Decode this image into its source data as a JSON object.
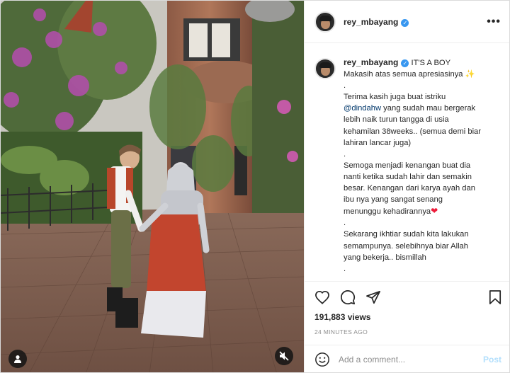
{
  "post": {
    "username": "rey_mbayang",
    "verified": true
  },
  "header": {
    "more_label": "•••"
  },
  "caption": {
    "title": "IT'S A BOY",
    "lines": [
      "Makasih atas semua apresiasinya",
      ".",
      "Terima kasih juga buat istriku",
      "yang sudah mau bergerak",
      "lebih naik turun tangga di usia",
      "kehamilan 38weeks.. (semua demi biar",
      "lahiran lancar juga)",
      ".",
      "Semoga menjadi kenangan buat dia",
      "nanti ketika sudah lahir dan semakin",
      "besar. Kenangan dari karya ayah dan",
      "ibu nya yang sangat senang",
      "menunggu kehadirannya",
      ".",
      "Sekarang ikhtiar sudah kita lakukan",
      "semampunya. selebihnya biar Allah",
      "yang bekerja.. bismillah",
      "."
    ],
    "mention": "@dindahw",
    "sparkle_emoji": "✨",
    "heart_emoji": "❤"
  },
  "stats": {
    "views_count": "191,883",
    "views_label": "views",
    "time": "24 MINUTES AGO"
  },
  "comment": {
    "placeholder": "Add a comment...",
    "post_label": "Post"
  },
  "colors": {
    "verified": "#3897f0",
    "mention": "#00376b",
    "post_disabled": "#b2dffc",
    "border": "#dbdbdb"
  },
  "icons": {
    "like": "heart-icon",
    "comment": "comment-icon",
    "share": "share-icon",
    "save": "bookmark-icon",
    "emoji": "smiley-icon",
    "tags": "user-tag-icon",
    "mute": "muted-speaker-icon"
  }
}
